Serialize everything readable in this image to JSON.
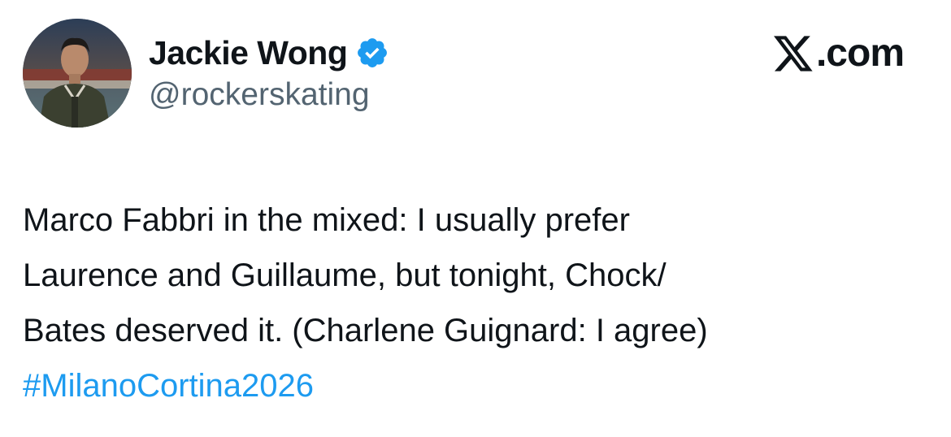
{
  "author": {
    "name": "Jackie Wong",
    "handle": "@rockerskating",
    "verified_icon": "verified-badge-icon",
    "verified_color": "#1d9bf0"
  },
  "brand": {
    "icon": "x-logo-icon",
    "text": ".com"
  },
  "tweet": {
    "lines": [
      "Marco Fabbri in the mixed: I usually prefer",
      "Laurence and Guillaume, but tonight, Chock/",
      "Bates deserved it. (Charlene Guignard: I agree)"
    ],
    "hashtag": "#MilanoCortina2026"
  },
  "colors": {
    "text": "#0f1419",
    "secondary": "#536471",
    "link": "#1d9bf0",
    "background": "#ffffff"
  }
}
